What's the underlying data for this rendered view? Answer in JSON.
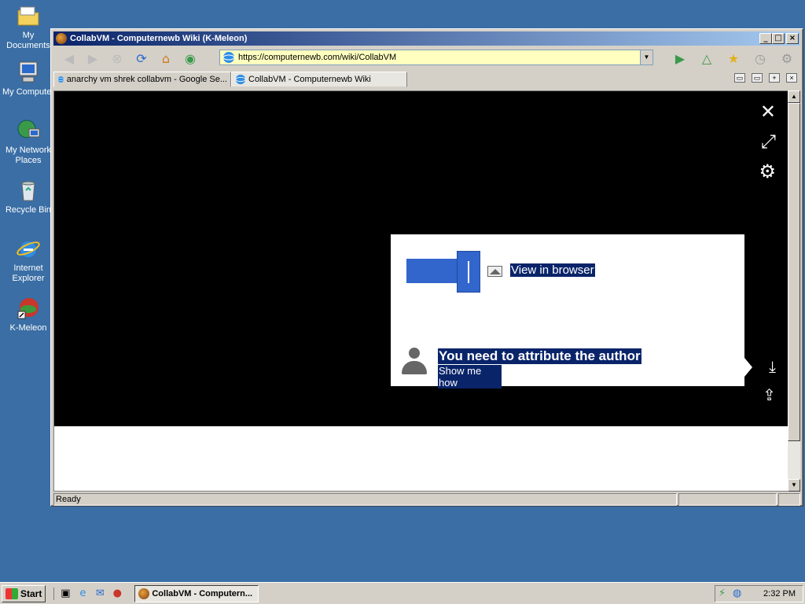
{
  "desktop": {
    "icons": [
      {
        "label": "My Documents",
        "icon": "folder-icon"
      },
      {
        "label": "My Computer",
        "icon": "computer-icon"
      },
      {
        "label": "My Network Places",
        "icon": "network-icon"
      },
      {
        "label": "Recycle Bin",
        "icon": "recycle-bin-icon"
      },
      {
        "label": "Internet Explorer",
        "icon": "ie-icon"
      },
      {
        "label": "K-Meleon",
        "icon": "kmeleon-icon"
      }
    ]
  },
  "window": {
    "title": "CollabVM - Computernewb Wiki (K-Meleon)",
    "controls": {
      "minimize": "_",
      "maximize": "□",
      "close": "×"
    }
  },
  "toolbar": {
    "url": "https://computernewb.com/wiki/CollabVM"
  },
  "tabs": [
    {
      "label": "anarchy vm shrek collabvm - Google Se...",
      "active": false
    },
    {
      "label": "CollabVM - Computernewb Wiki",
      "active": true
    }
  ],
  "content": {
    "popup": {
      "view_in_browser": "View in browser",
      "attribution_title": "You need to attribute the author",
      "attribution_link": "Show me how"
    }
  },
  "statusbar": {
    "text": "Ready"
  },
  "taskbar": {
    "start_label": "Start",
    "task_label": "CollabVM - Computern...",
    "clock": "2:32 PM"
  },
  "colors": {
    "desktop": "#3a6ea5",
    "selection": "#0a246a",
    "accent_blue": "#3366cc"
  }
}
